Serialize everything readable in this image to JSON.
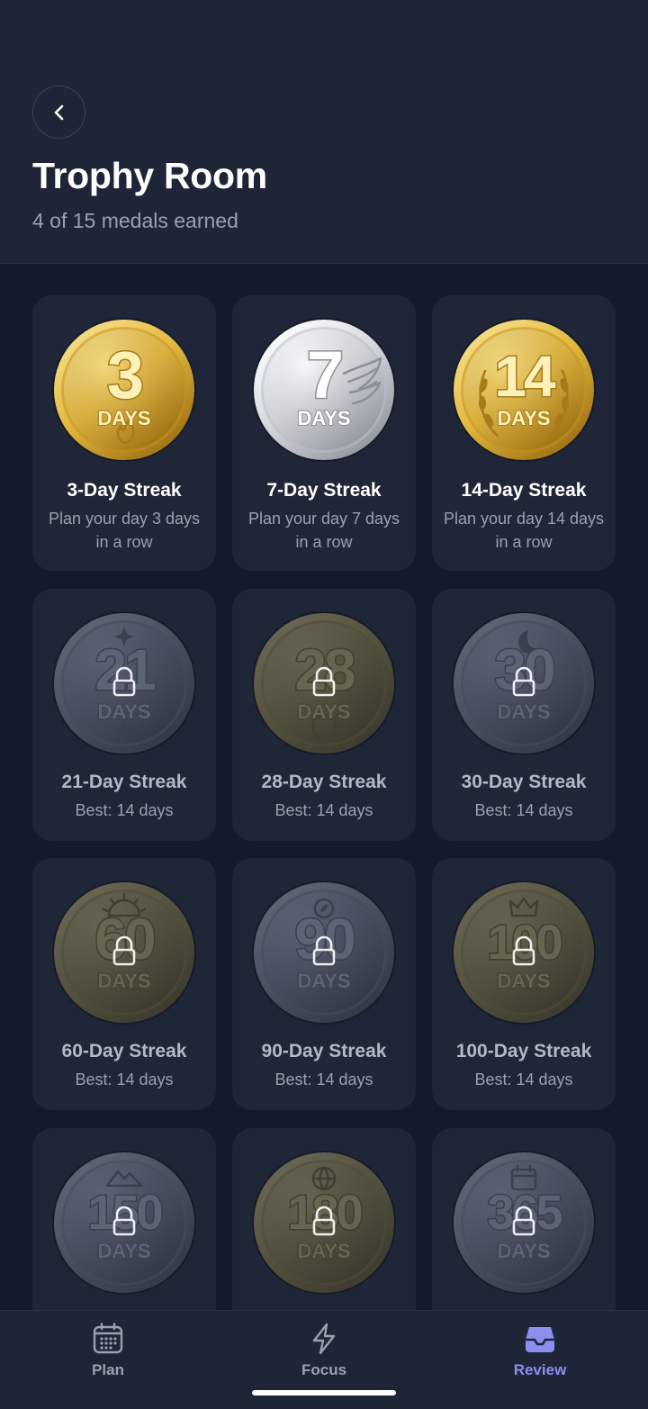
{
  "header": {
    "title": "Trophy Room",
    "subtitle": "4 of 15 medals earned",
    "back_icon": "chevron-left-icon"
  },
  "medals": [
    {
      "number": "3",
      "unit": "DAYS",
      "title": "3-Day Streak",
      "desc": "Plan your day 3 days in a row",
      "earned": true,
      "finish": "gold",
      "emblem": "flame-icon"
    },
    {
      "number": "7",
      "unit": "DAYS",
      "title": "7-Day Streak",
      "desc": "Plan your day 7 days in a row",
      "earned": true,
      "finish": "silver",
      "emblem": "wing-icon"
    },
    {
      "number": "14",
      "unit": "DAYS",
      "title": "14-Day Streak",
      "desc": "Plan your day 14 days in a row",
      "earned": true,
      "finish": "gold",
      "emblem": "laurel-icon"
    },
    {
      "number": "21",
      "unit": "DAYS",
      "title": "21-Day Streak",
      "desc": "Best: 14 days",
      "earned": false,
      "finish": "steel",
      "emblem": "sparkle-icon"
    },
    {
      "number": "28",
      "unit": "DAYS",
      "title": "28-Day Streak",
      "desc": "Best: 14 days",
      "earned": false,
      "finish": "bronze",
      "emblem": "shield-icon"
    },
    {
      "number": "30",
      "unit": "DAYS",
      "title": "30-Day Streak",
      "desc": "Best: 14 days",
      "earned": false,
      "finish": "steel",
      "emblem": "moon-icon"
    },
    {
      "number": "60",
      "unit": "DAYS",
      "title": "60-Day Streak",
      "desc": "Best: 14 days",
      "earned": false,
      "finish": "bronze",
      "emblem": "sunrise-icon"
    },
    {
      "number": "90",
      "unit": "DAYS",
      "title": "90-Day Streak",
      "desc": "Best: 14 days",
      "earned": false,
      "finish": "steel",
      "emblem": "compass-icon"
    },
    {
      "number": "100",
      "unit": "DAYS",
      "title": "100-Day Streak",
      "desc": "Best: 14 days",
      "earned": false,
      "finish": "bronze",
      "emblem": "crown-icon"
    },
    {
      "number": "150",
      "unit": "DAYS",
      "title": "",
      "desc": "",
      "earned": false,
      "finish": "steel",
      "emblem": "mountain-icon"
    },
    {
      "number": "180",
      "unit": "DAYS",
      "title": "",
      "desc": "",
      "earned": false,
      "finish": "bronze",
      "emblem": "globe-icon"
    },
    {
      "number": "365",
      "unit": "DAYS",
      "title": "",
      "desc": "",
      "earned": false,
      "finish": "steel",
      "emblem": "calendar-icon"
    }
  ],
  "tabs": [
    {
      "label": "Plan",
      "icon": "calendar-icon",
      "active": false
    },
    {
      "label": "Focus",
      "icon": "lightning-icon",
      "active": false
    },
    {
      "label": "Review",
      "icon": "inbox-tray-icon",
      "active": true
    }
  ],
  "colors": {
    "background": "#141a2b",
    "card": "#1f2637",
    "header": "#1e2536",
    "accent": "#8b8ff0",
    "muted_text": "#9aa1b1"
  }
}
